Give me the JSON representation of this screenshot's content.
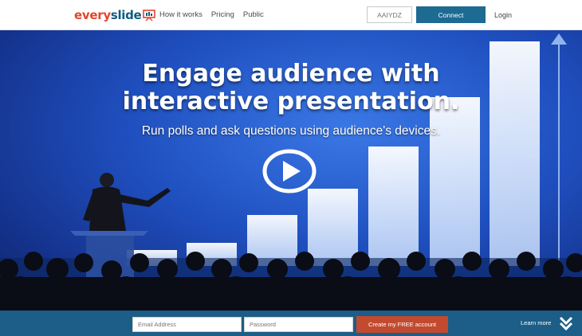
{
  "header": {
    "logo_every": "every",
    "logo_slide": "slide",
    "nav": [
      "How it works",
      "Pricing",
      "Public"
    ],
    "code_placeholder": "AAIYDZ",
    "connect_label": "Connect",
    "login_label": "Login"
  },
  "hero": {
    "headline_line1": "Engage audience with",
    "headline_line2": "interactive presentation.",
    "subline": "Run polls and ask questions using audience's devices."
  },
  "signup": {
    "email_placeholder": "Email Address",
    "password_placeholder": "Password",
    "create_label": "Create my FREE account",
    "learn_more": "Learn more"
  },
  "colors": {
    "brand_red": "#e2452b",
    "brand_blue": "#0d5b82",
    "bar_blue": "#1c5e87",
    "cta_red": "#c34a2e"
  },
  "icons": [
    "logo-presentation-icon",
    "play-icon",
    "double-chevron-down-icon"
  ]
}
